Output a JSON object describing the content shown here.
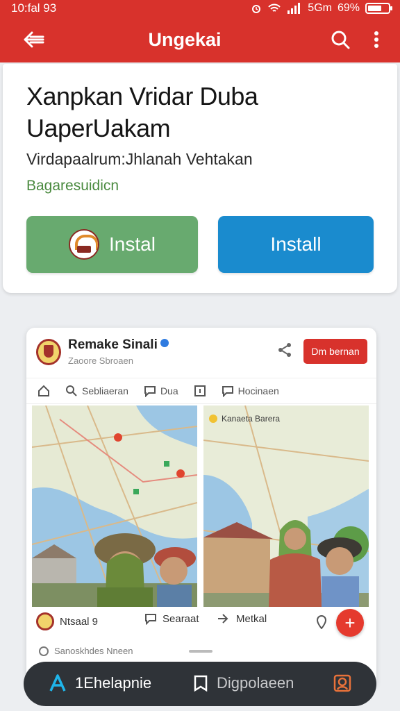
{
  "status_bar": {
    "time": "10:fal 93",
    "network": "5Gm",
    "battery": "69%",
    "battery_level": 0.69
  },
  "app_bar": {
    "title": "Ungekai"
  },
  "hero": {
    "title": "Xanpkan Vridar Duba UaperUakam",
    "subtitle": "Virdapaalrum:Jhlanah Vehtakan",
    "meta": "Bagaresuidicn",
    "primary_button": "Instal",
    "secondary_button": "Install"
  },
  "post": {
    "page_name": "Remake Sinali",
    "handle": "Zaoore Sbroaen",
    "follow_label": "Dm bernan",
    "tabs": [
      "Sebliaeran",
      "Dua",
      "",
      "Hocinaen"
    ],
    "left_footer": "Ntsaal 9",
    "left_comment": "Searaat",
    "right_footer": "Metkal",
    "right_overlay": "Kanaeta Barera",
    "hint": "Sanoskhdes Nneen"
  },
  "bottom_nav": {
    "item1": "1Ehelapnie",
    "item2": "Digpolaeen"
  },
  "colors": {
    "brand_red": "#d8322c",
    "install_green": "#68aa6f",
    "install_blue": "#1a8bce",
    "nav_dark": "#2f3338",
    "accent_cyan": "#1fb5ea"
  }
}
